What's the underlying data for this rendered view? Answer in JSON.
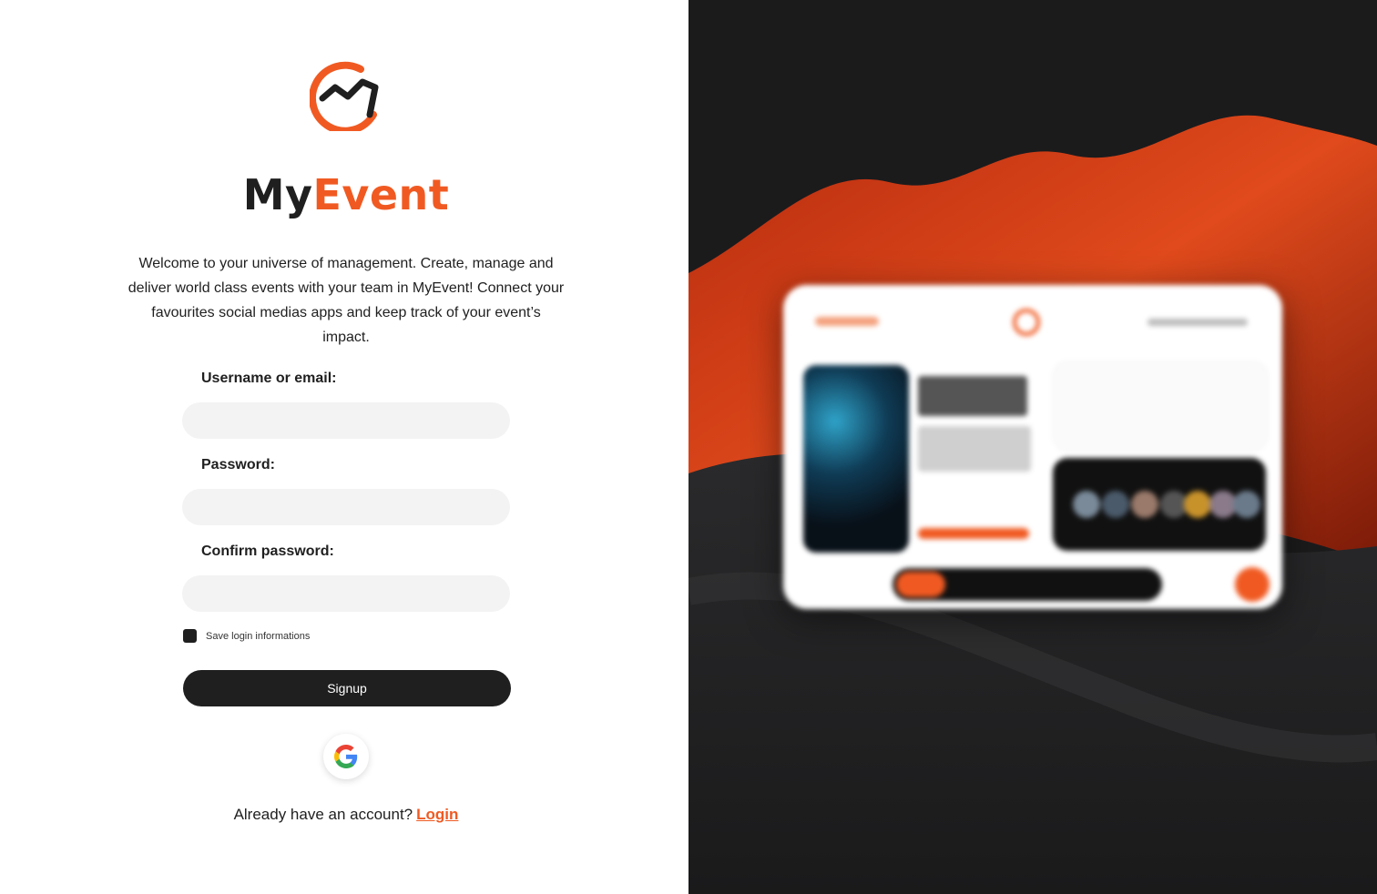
{
  "brand": {
    "name_part1": "My",
    "name_part2": "Event"
  },
  "intro_text": "Welcome to your universe of management. Create, manage and deliver world class events with your team in MyEvent! Connect your favourites social medias apps and keep track of your event’s impact.",
  "form": {
    "username_label": "Username or email:",
    "username_value": "",
    "password_label": "Password:",
    "password_value": "",
    "confirm_label": "Confirm password:",
    "confirm_value": "",
    "remember_label": "Save login informations",
    "signup_label": "Signup"
  },
  "footer": {
    "prompt": "Already have an account?",
    "login_link": "Login"
  },
  "colors": {
    "accent": "#f05a22",
    "dark": "#1f1f1f",
    "field_bg": "#f3f3f3",
    "right_bg": "#1b1b1c"
  },
  "icons": {
    "google": "google-icon",
    "logo": "myevent-logo"
  }
}
